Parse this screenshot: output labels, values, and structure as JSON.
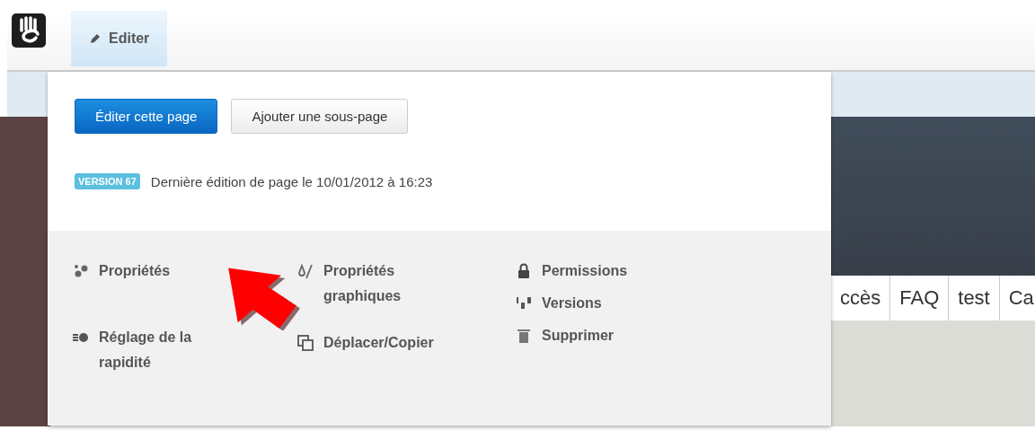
{
  "toolbar": {
    "tabs": [
      {
        "label": "Editer",
        "selected": true
      }
    ]
  },
  "panel": {
    "buttons": [
      {
        "label": "Éditer cette page",
        "kind": "primary"
      },
      {
        "label": "Ajouter une sous-page",
        "kind": "secondary"
      }
    ],
    "version": {
      "badge": "VERSION 67",
      "text": "Dernière édition de page le 10/01/2012 à 16:23"
    },
    "menu_columns": [
      [
        {
          "label": "Propriétés"
        },
        {
          "label": "Réglage de la rapidité"
        }
      ],
      [
        {
          "label": "Propriétés graphiques"
        },
        {
          "label": "Déplacer/Copier"
        }
      ],
      [
        {
          "label": "Permissions"
        },
        {
          "label": "Versions"
        },
        {
          "label": "Supprimer"
        }
      ]
    ]
  },
  "site_nav": [
    "ccès",
    "FAQ",
    "test",
    "Ca"
  ]
}
